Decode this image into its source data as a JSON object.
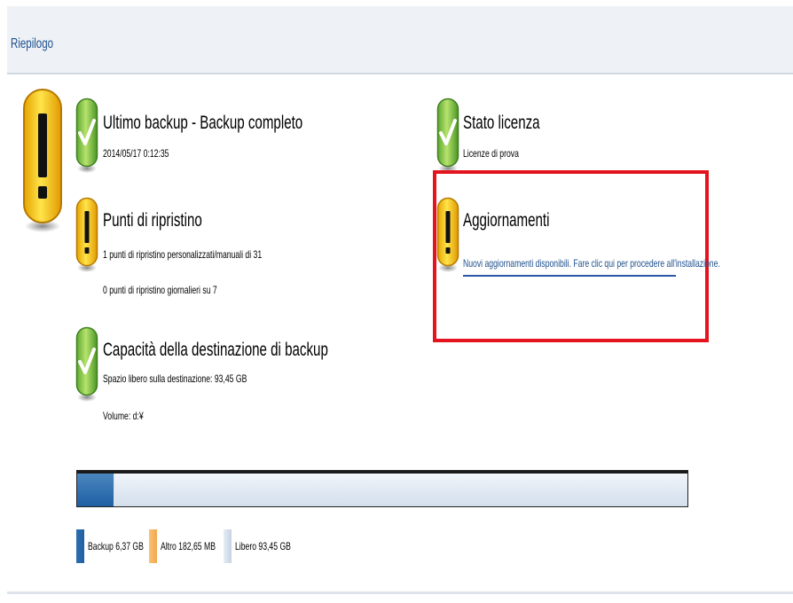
{
  "header": {
    "title": "Riepilogo"
  },
  "backup": {
    "title": "Ultimo backup - Backup completo",
    "date": "2014/05/17 0:12:35",
    "status_icon": "check-icon"
  },
  "restore_points": {
    "title": "Punti di ripristino",
    "line1": "1 punti di ripristino personalizzati/manuali di 31",
    "line2": "0 punti di ripristino giornalieri su 7",
    "status_icon": "warning-icon"
  },
  "capacity": {
    "title": "Capacità della destinazione di backup",
    "free_text": "Spazio libero sulla destinazione: 93,45 GB",
    "volume": "Volume: d:¥",
    "status_icon": "check-icon"
  },
  "license": {
    "title": "Stato licenza",
    "value": "Licenze di prova",
    "status_icon": "check-icon"
  },
  "updates": {
    "title": "Aggiornamenti",
    "link": "Nuovi aggiornamenti disponibili. Fare clic qui per procedere all'installazione.",
    "status_icon": "warning-icon",
    "highlight_color": "#e4141f"
  },
  "storage_bar": {
    "backup_fraction": 0.06,
    "other_fraction": 0.0017,
    "free_fraction": 0.9383,
    "colors": {
      "backup": "#1f5fa2",
      "other": "#f3a84a",
      "free": "#d3dfec"
    }
  },
  "legend": {
    "backup_label": "Backup 6,37 GB",
    "other_label": "Altro 182,65 MB",
    "free_label": "Libero 93,45 GB"
  }
}
